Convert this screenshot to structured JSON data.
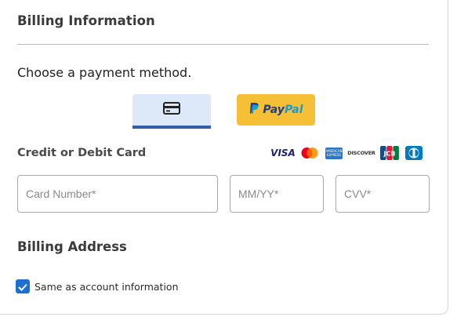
{
  "section": {
    "title": "Billing Information",
    "prompt": "Choose a payment method."
  },
  "payment_methods": {
    "card_icon": "credit-card-icon",
    "paypal": {
      "pay": "Pay",
      "pal": "Pal",
      "bg_color": "#f5c036"
    },
    "selected": "card",
    "selected_color": "#2f5fa6"
  },
  "card": {
    "title": "Credit or Debit Card",
    "brands": {
      "visa": "VISA",
      "amex": "AMERICAN EXPRESS",
      "discover": "DISCOVER"
    },
    "brand_icons": [
      "visa-icon",
      "mastercard-icon",
      "amex-icon",
      "discover-icon",
      "jcb-icon",
      "diners-club-icon"
    ],
    "fields": {
      "number_placeholder": "Card Number*",
      "expiry_placeholder": "MM/YY*",
      "cvv_placeholder": "CVV*",
      "number_value": "",
      "expiry_value": "",
      "cvv_value": ""
    }
  },
  "billing_address": {
    "title": "Billing Address",
    "same_as_account_label": "Same as account information",
    "same_as_account_checked": true,
    "checkbox_color": "#1f6fd1"
  }
}
